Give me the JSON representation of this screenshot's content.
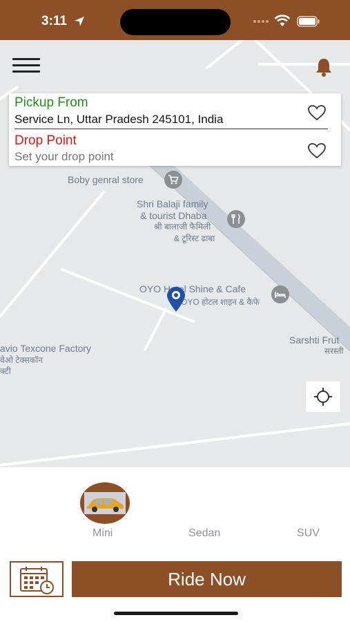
{
  "status_bar": {
    "time": "3:11"
  },
  "map": {
    "labels": {
      "boby_store": "Boby genral store",
      "balaji_en_1": "Shri Balaji family",
      "balaji_en_2": "& tourist Dhaba",
      "balaji_hi_1": "श्री बालाजी फैमिली",
      "balaji_hi_2": "& टूरिस्ट ढाबा",
      "oyo_en": "OYO Hotel Shine & Cafe",
      "oyo_hi": "OYO होटल शाइन & कैफे",
      "factory_en": "avio Texcone Factory",
      "factory_hi_1": "वेओ टेक्सकॉन",
      "factory_hi_2": "क्टी",
      "sarshti_en": "Sarshti Frut",
      "sarshti_hi": "सरस्ती"
    }
  },
  "address": {
    "pickup_title": "Pickup From",
    "pickup_value": "Service Ln, Uttar Pradesh 245101, India",
    "drop_title": "Drop Point",
    "drop_placeholder": "Set your drop point"
  },
  "cars": [
    {
      "label": "Mini"
    },
    {
      "label": "Sedan"
    },
    {
      "label": "SUV"
    }
  ],
  "actions": {
    "ride_now": "Ride Now"
  },
  "colors": {
    "brand": "#8d4f26",
    "pickup": "#1f8b1f",
    "drop": "#e01414",
    "pin": "#1f4fa8"
  }
}
